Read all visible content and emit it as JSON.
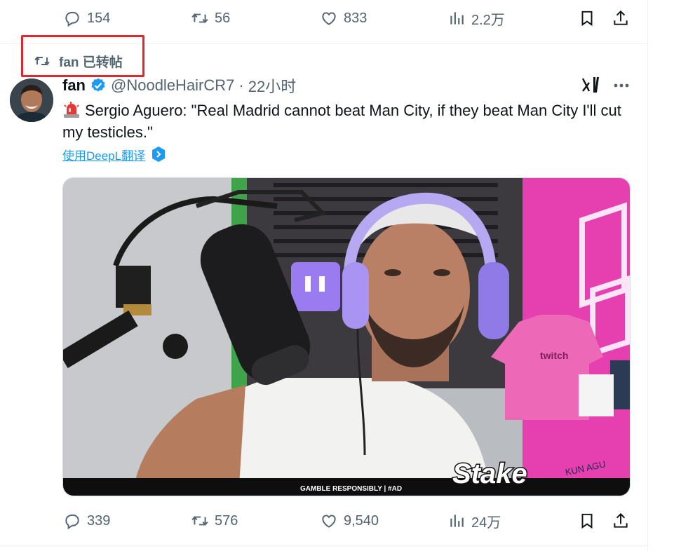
{
  "top_actions": {
    "replies": "154",
    "reposts": "56",
    "likes": "833",
    "views": "2.2万"
  },
  "repost_banner": {
    "user": "fan",
    "text": "fan 已转帖"
  },
  "tweet": {
    "name": "fan",
    "handle": "@NoodleHairCR7",
    "dot": "·",
    "time": "22小时",
    "text": "Sergio Aguero: \"Real Madrid cannot beat Man City, if they beat Man City I'll cut my testicles.\"",
    "translate_label": "使用DeepL翻译",
    "media": {
      "caption_bar": "GAMBLE RESPONSIBLY | #AD",
      "watermark": "Stake",
      "shirt_text": "twitch",
      "corner_text": "KUN AGU"
    },
    "actions": {
      "replies": "339",
      "reposts": "576",
      "likes": "9,540",
      "views": "24万"
    }
  },
  "colors": {
    "muted": "#536471",
    "accent": "#1d9bf0",
    "highlight_box": "#e0282c",
    "verified": "#1d9bf0"
  },
  "icons": [
    "reply-icon",
    "repost-icon",
    "like-icon",
    "views-icon",
    "bookmark-icon",
    "share-icon",
    "verified-icon",
    "grok-icon",
    "more-icon",
    "deepl-icon",
    "siren-emoji"
  ]
}
